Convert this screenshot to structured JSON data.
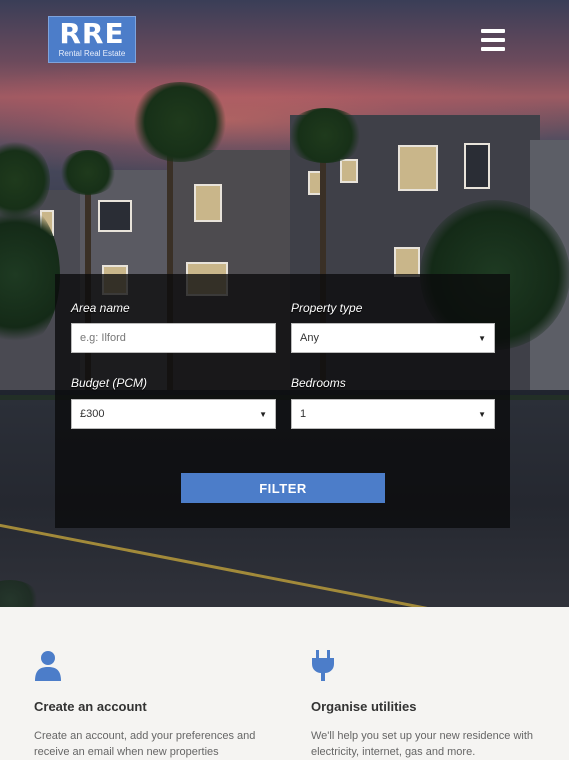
{
  "header": {
    "logo_text": "RRE",
    "logo_subtext": "Rental Real Estate"
  },
  "search_form": {
    "area_label": "Area name",
    "area_placeholder": "e.g: Ilford",
    "property_type_label": "Property type",
    "property_type_value": "Any",
    "budget_label": "Budget (PCM)",
    "budget_value": "£300",
    "bedrooms_label": "Bedrooms",
    "bedrooms_value": "1",
    "submit_label": "FILTER"
  },
  "features": [
    {
      "icon": "user-icon",
      "title": "Create an account",
      "text": "Create an account, add your preferences and receive an email when new properties"
    },
    {
      "icon": "plug-icon",
      "title": "Organise utilities",
      "text": "We'll help you set up your new residence with electricity, internet, gas and more."
    }
  ],
  "colors": {
    "accent": "#4c7dc9",
    "page_background": "#f5f4f2"
  }
}
